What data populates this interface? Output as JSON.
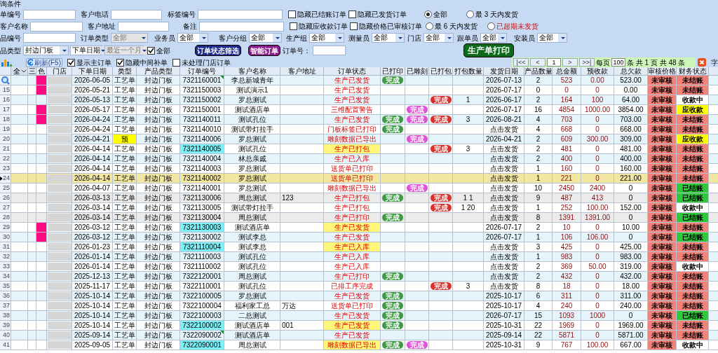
{
  "panel": {
    "title": "询条件"
  },
  "filter_lines": [
    [
      {
        "kind": "text",
        "label": "单编号"
      },
      {
        "kind": "text",
        "label": "客户电话"
      },
      {
        "kind": "text",
        "label": "标签编号"
      },
      {
        "kind": "check",
        "label": "隐藏已结账订单",
        "checked": false
      },
      {
        "kind": "check",
        "label": "隐藏已发货订单",
        "checked": false
      },
      {
        "kind": "radio",
        "label": "全部",
        "selected": true
      },
      {
        "kind": "radio",
        "label": "最 3 天内发货",
        "selected": false
      }
    ],
    [
      {
        "kind": "text",
        "label": "客户名称"
      },
      {
        "kind": "text",
        "label": "客户地址"
      },
      {
        "kind": "text",
        "label": "备注"
      },
      {
        "kind": "check",
        "label": "隐藏应收款订单",
        "checked": false
      },
      {
        "kind": "check",
        "label": "隐藏价格已审核订单",
        "checked": false
      },
      {
        "kind": "radio",
        "label": "最 6 天内发货",
        "selected": false
      },
      {
        "kind": "radio",
        "label": "已超期未发货",
        "selected": false,
        "warning": true
      }
    ],
    [
      {
        "kind": "text",
        "label": "品编号"
      },
      {
        "kind": "select",
        "label": "订单类型",
        "value": "全部",
        "disabled": true
      },
      {
        "kind": "select",
        "label": "业务员",
        "value": "全部",
        "disabled": false
      },
      {
        "kind": "select",
        "label": "客户分组",
        "value": "全部",
        "disabled": false
      },
      {
        "kind": "select",
        "label": "生产组",
        "value": "全部",
        "disabled": false
      },
      {
        "kind": "select",
        "label": "测量员",
        "value": "全部",
        "disabled": false
      },
      {
        "kind": "select",
        "label": "门店",
        "value": "全部",
        "disabled": false
      },
      {
        "kind": "select",
        "label": "跟单员",
        "value": "全部",
        "disabled": false
      },
      {
        "kind": "select",
        "label": "安装员",
        "value": "全部",
        "disabled": false
      }
    ],
    [
      {
        "kind": "select",
        "label": "品类型",
        "value": "封边门板",
        "disabled": false
      },
      {
        "kind": "select",
        "value": "下单日期",
        "disabled": false
      },
      {
        "kind": "select",
        "value": "最近一个月",
        "disabled": true
      },
      {
        "kind": "check",
        "label": "全部",
        "checked": true
      },
      {
        "kind": "button",
        "label": "订单状态筛选",
        "color": "#1c2a8a"
      },
      {
        "kind": "button",
        "label": "智能订单",
        "color": "#8a1a8a"
      },
      {
        "kind": "text",
        "label": "订单号："
      },
      {
        "kind": "button",
        "label": "生产单打印",
        "color": "#0b6b1a"
      }
    ]
  ],
  "toolbar": {
    "refresh": "刷新(F5)",
    "checks": [
      {
        "label": "显示主订单",
        "checked": true
      },
      {
        "label": "隐藏中间补单",
        "checked": true
      },
      {
        "label": "未处理门店订单",
        "checked": false
      }
    ]
  },
  "pagination": {
    "first": "|<<",
    "prev": "<",
    "page": "1",
    "next": ">",
    "last": ">>|",
    "per_page_label": "每页",
    "per_page": "100",
    "summary": "条 共 1 页 共 48 条",
    "cut_label": "字"
  },
  "columns": [
    "全",
    "三",
    "色",
    "门店",
    "下单日期",
    "类型",
    "产品类型",
    "订单编号",
    "客户名称",
    "客户地址",
    "订单状态",
    "已打印",
    "已雕刻",
    "已打包",
    "打包数量",
    "发货日期",
    "产品数量",
    "总金额",
    "预收款",
    "总欠款",
    "审核价格",
    "财务状态"
  ],
  "rows": [
    {
      "selected": false,
      "grayed": false,
      "color": "#ff0a80",
      "date": "2026-06-05",
      "type": "工艺单",
      "product": "封边门板",
      "order": "7321160001",
      "note": true,
      "customer": "李总新城青年",
      "status": "生产已发货",
      "printed": "完成",
      "ship": "2026-07-13",
      "qty": "2",
      "total": "523",
      "prepaid": "0.00",
      "owing": "523.00",
      "audit": "未审核",
      "finance": {
        "label": "未结账",
        "color": "#f2827a"
      }
    },
    {
      "no": "15",
      "selected": false,
      "grayed": false,
      "color": "#ff0a80",
      "date": "2026-05-21",
      "type": "工艺单",
      "product": "封边门板",
      "order": "7321150003",
      "customer": "测试演示1",
      "status": "生产已发货",
      "ship": "2026-07-17",
      "qty": "0",
      "total": "0",
      "prepaid": "0",
      "owing": "0.00",
      "audit": "未审核",
      "finance": {
        "label": "未结账",
        "color": "#f2827a"
      }
    },
    {
      "no": "16",
      "selected": false,
      "grayed": false,
      "date": "2026-05-13",
      "type": "工艺单",
      "product": "封边门板",
      "order": "7321150002",
      "customer": "罗总测试",
      "status": "生产已发货",
      "packed": "完成",
      "pack_qty": "1",
      "ship": "2026-06-17",
      "qty": "2",
      "total": "164",
      "prepaid": "100",
      "owing": "64.00",
      "audit": "未审核",
      "finance": {
        "label": "收款中",
        "color": "#ffffff"
      }
    },
    {
      "no": "17",
      "selected": false,
      "grayed": false,
      "color": "#ff0a80",
      "date": "2026-05-17",
      "type": "工艺单",
      "product": "封边门板",
      "order": "7321150001",
      "customer": "测试酒店单",
      "status": "三维配置警告",
      "engraved": "完成",
      "ship": "2026-07-17",
      "qty": "16",
      "total": "4854",
      "prepaid": "1000.00",
      "owing": "3854.00",
      "audit": "未审核",
      "finance": {
        "label": "应收款",
        "color": "#ffff00"
      }
    },
    {
      "no": "18",
      "selected": false,
      "grayed": false,
      "color": "#ff0a80",
      "date": "2026-04-24",
      "type": "工艺单",
      "product": "封边门板",
      "order": "7321140011",
      "customer": "测试孔位",
      "status": "生产已发货",
      "printed": "完成",
      "engraved": "完成",
      "packed": "完成",
      "pack_qty": "3",
      "ship": "2026-08-21",
      "qty": "4",
      "total": "703",
      "prepaid": "0",
      "owing": "703.00",
      "audit": "未审核",
      "finance": {
        "label": "未结账",
        "color": "#f2827a"
      }
    },
    {
      "no": "19",
      "selected": false,
      "grayed": false,
      "date": "2026-04-24",
      "type": "工艺单",
      "product": "封边门板",
      "order": "7321140010",
      "customer": "测试带灯拉手",
      "status": "门板标签已打印",
      "printed": "完成",
      "ship": "点击发货",
      "qty": "4",
      "total": "668",
      "prepaid": "0",
      "owing": "668.00",
      "audit": "未审核",
      "finance": {
        "label": "未结账",
        "color": "#f2827a"
      }
    },
    {
      "no": "20",
      "selected": false,
      "grayed": false,
      "date": "2026-04-21",
      "type": "预",
      "type_hl": true,
      "product": "封边门板",
      "order": "7321140006",
      "customer": "罗总测试",
      "status": "雕刻数据已导出",
      "engraved": "完成",
      "ship": "2026-04-21",
      "qty": "2",
      "total": "609",
      "prepaid": "300.00",
      "owing": "309.00",
      "audit": "未审核",
      "finance": {
        "label": "应收款",
        "color": "#ffff00"
      }
    },
    {
      "no": "21",
      "selected": false,
      "grayed": false,
      "date": "2026-04-14",
      "type": "工艺单",
      "product": "封边门板",
      "order": "7321140005",
      "order_hl": true,
      "customer": "测试孔位",
      "status": "生产已打包",
      "status_hl": true,
      "packed": "完成",
      "pack_qty": "3",
      "ship": "点击发货",
      "qty": "2",
      "total": "481",
      "prepaid": "0",
      "owing": "481.00",
      "audit": "未审核",
      "finance": {
        "label": "未结账",
        "color": "#f2827a"
      }
    },
    {
      "no": "22",
      "selected": false,
      "grayed": false,
      "date": "2026-04-14",
      "type": "工艺单",
      "product": "封边门板",
      "order": "7321140004",
      "customer": "林总亲戚",
      "status": "生产已入库",
      "ship": "点击发货",
      "qty": "2",
      "total": "400",
      "prepaid": "0",
      "owing": "400.00",
      "audit": "未审核",
      "finance": {
        "label": "未结账",
        "color": "#f2827a"
      }
    },
    {
      "no": "23",
      "selected": false,
      "grayed": false,
      "date": "2026-04-14",
      "type": "工艺单",
      "product": "封边门板",
      "order": "7321140003",
      "customer": "罗总测试",
      "status": "送货单已打印",
      "ship": "点击发货",
      "qty": "1",
      "total": "160",
      "prepaid": "0",
      "owing": "160.00",
      "audit": "未审核",
      "finance": {
        "label": "未结账",
        "color": "#f2827a"
      }
    },
    {
      "no": "24",
      "selected": true,
      "grayed": false,
      "date": "2026-04-14",
      "type": "工艺单",
      "product": "封边门板",
      "order": "7321140002",
      "customer": "罗总测试",
      "status": "送货单已打印",
      "ship": "点击发货",
      "qty": "1",
      "total": "221",
      "prepaid": "0",
      "owing": "221.00",
      "audit": "未审核",
      "finance": {
        "label": "未结账",
        "color": "#f2827a"
      }
    },
    {
      "no": "25",
      "selected": false,
      "grayed": false,
      "date": "2026-04-07",
      "type": "工艺单",
      "product": "封边门板",
      "order": "7321140001",
      "customer": "罗总测试",
      "status": "雕刻数据已导出",
      "engraved": "完成",
      "ship": "点击发货",
      "qty": "10",
      "total": "2450",
      "prepaid": "2400",
      "owing": "0",
      "audit": "未审核",
      "finance": {
        "label": "已结账",
        "color": "#2fca3a"
      }
    },
    {
      "no": "26",
      "selected": false,
      "grayed": true,
      "date": "2026-03-13",
      "type": "工艺单",
      "product": "封边门板",
      "order": "7321130006",
      "customer": "周总测试",
      "address": "123",
      "status": "生产已打包",
      "printed": "完成",
      "packed": "完成",
      "pack_qty": "1 1",
      "ship": "点击发货",
      "qty": "9",
      "total": "487",
      "prepaid": "413",
      "owing": "0",
      "audit": "未审核",
      "finance": {
        "label": "已结账",
        "color": "#2fca3a"
      }
    },
    {
      "no": "27",
      "selected": false,
      "grayed": false,
      "date": "2026-03-14",
      "type": "工艺单",
      "product": "封边门板",
      "order": "7321130005",
      "customer": "测试带灯拉手",
      "status": "生产已打包",
      "packed": "完成",
      "pack_qty": "1 20",
      "ship": "点击发货",
      "qty": "1",
      "total": "252",
      "prepaid": "100.00",
      "owing": "152.00",
      "audit": "未审核",
      "finance": {
        "label": "收款中",
        "color": "#ffffff"
      }
    },
    {
      "no": "28",
      "selected": false,
      "grayed": true,
      "date": "2026-03-14",
      "type": "工艺单",
      "product": "封边门板",
      "order": "7321130004",
      "customer": "周总测试",
      "status": "生产已打印",
      "printed": "完成",
      "ship": "点击发货",
      "qty": "8",
      "total": "1391",
      "prepaid": "1391.00",
      "owing": "0",
      "audit": "未审核",
      "finance": {
        "label": "已结账",
        "color": "#2fca3a"
      }
    },
    {
      "no": "29",
      "selected": false,
      "grayed": false,
      "color": "#ff0a80",
      "date": "2026-03-12",
      "type": "工艺单",
      "product": "封边门板",
      "order": "7321130003",
      "order_hl": true,
      "customer": "测试酒店单",
      "status": "生产已发货",
      "status_hl": true,
      "ship": "2026-07-17",
      "qty": "2",
      "total": "10",
      "prepaid": "0",
      "owing": "10.00",
      "audit": "未审核",
      "finance": {
        "label": "未结账",
        "color": "#f2827a"
      }
    },
    {
      "no": "30",
      "selected": false,
      "grayed": false,
      "color": "#ff0a80",
      "date": "2026-03-12",
      "type": "工艺单",
      "product": "封边门板",
      "order": "7321130002",
      "customer": "测试李总",
      "status": "生产已发货",
      "ship": "2026-07-17",
      "qty": "1",
      "total": "106",
      "prepaid": "106.00",
      "owing": "0",
      "audit": "未审核",
      "finance": {
        "label": "已结账",
        "color": "#2fca3a"
      }
    },
    {
      "no": "31",
      "selected": false,
      "grayed": false,
      "date": "2026-01-23",
      "type": "工艺单",
      "product": "封边门板",
      "order": "7321110004",
      "order_hl": true,
      "customer": "测试李总",
      "status": "生产已入库",
      "status_hl": true,
      "ship": "点击发货",
      "qty": "3",
      "total": "425",
      "prepaid": "0",
      "owing": "425.00",
      "audit": "未审核",
      "finance": {
        "label": "未结账",
        "color": "#f2827a"
      }
    },
    {
      "no": "32",
      "selected": false,
      "grayed": false,
      "date": "2026-01-14",
      "type": "工艺单",
      "product": "封边门板",
      "order": "7321110003",
      "customer": "测试孔位",
      "status": "生产已入库",
      "ship": "点击发货",
      "qty": "1",
      "total": "983",
      "prepaid": "0",
      "owing": "983.00",
      "audit": "未审核",
      "finance": {
        "label": "未结账",
        "color": "#f2827a"
      }
    },
    {
      "no": "33",
      "selected": false,
      "grayed": false,
      "date": "2026-01-14",
      "type": "工艺单",
      "product": "封边门板",
      "order": "7321110002",
      "customer": "测试孔位",
      "status": "生产已入库",
      "ship": "点击发货",
      "qty": "2",
      "total": "369",
      "prepaid": "50.00",
      "owing": "319.00",
      "audit": "未审核",
      "finance": {
        "label": "收款中",
        "color": "#ffffff"
      }
    },
    {
      "no": "34",
      "selected": false,
      "grayed": false,
      "date": "2025-12-13",
      "type": "工艺单",
      "product": "封边门板",
      "order": "7322120001",
      "customer": "周总测试",
      "status": "生产已打印",
      "printed": "完成",
      "ship": "点击发货",
      "qty": "2",
      "total": "432",
      "prepaid": "0",
      "owing": "432.00",
      "audit": "未审核",
      "finance": {
        "label": "未结账",
        "color": "#f2827a"
      }
    },
    {
      "no": "35",
      "selected": false,
      "grayed": false,
      "date": "2025-11-17",
      "type": "工艺单",
      "product": "封边门板",
      "order": "7322110001",
      "customer": "测试孔位",
      "status": "已排工序完成",
      "packed": "完成",
      "pack_qty": "3",
      "ship": "点击发货",
      "qty": "8",
      "total": "18",
      "prepaid": "0",
      "owing": "18.00",
      "audit": "未审核",
      "finance": {
        "label": "未结账",
        "color": "#f2827a"
      }
    },
    {
      "no": "36",
      "selected": false,
      "grayed": false,
      "date": "2025-10-14",
      "type": "工艺单",
      "product": "封边门板",
      "order": "7322100005",
      "customer": "罗总测试",
      "status": "生产已发货",
      "printed": "完成",
      "ship": "2025-10-17",
      "qty": "6",
      "total": "311",
      "prepaid": "0",
      "owing": "311.00",
      "audit": "未审核",
      "finance": {
        "label": "未结账",
        "color": "#f2827a"
      }
    },
    {
      "no": "37",
      "selected": false,
      "grayed": false,
      "date": "2025-10-14",
      "type": "工艺单",
      "product": "封边门板",
      "order": "7322100004",
      "customer": "福利家工总",
      "address": "万达",
      "status": "送货单已打印",
      "printed": "完成",
      "ship": "2025-10-17",
      "qty": "4",
      "total": "240",
      "prepaid": "0",
      "owing": "240.00",
      "audit": "未审核",
      "finance": {
        "label": "未结账",
        "color": "#f2827a"
      }
    },
    {
      "no": "38",
      "selected": false,
      "grayed": false,
      "date": "2025-10-14",
      "type": "工艺单",
      "product": "封边门板",
      "order": "7322100003",
      "customer": "二总测试",
      "status": "生产已发货",
      "printed": "完成",
      "ship": "2026-07-17",
      "qty": "15",
      "total": "1093",
      "prepaid": "1000",
      "owing": "0",
      "audit": "未审核",
      "finance": {
        "label": "已结账",
        "color": "#2fca3a"
      }
    },
    {
      "no": "39",
      "selected": false,
      "grayed": false,
      "date": "2025-10-14",
      "type": "工艺单",
      "product": "封边门板",
      "order": "7322100002",
      "order_hl": true,
      "customer": "测试酒店单",
      "address": "001",
      "status": "生产已发货",
      "status_hl": true,
      "printed": "完成",
      "ship": "2025-10-31",
      "qty": "22",
      "total": "1969",
      "prepaid": "0",
      "owing": "1969.00",
      "audit": "未审核",
      "finance": {
        "label": "未结账",
        "color": "#f2827a"
      }
    },
    {
      "no": "40",
      "selected": false,
      "grayed": false,
      "date": "2025-09-14",
      "type": "工艺单",
      "product": "封边门板",
      "order": "7322090002",
      "note": true,
      "customer": "测试酒店单",
      "status": "生产已发货",
      "ship": "2025-09-14",
      "qty": "22",
      "total": "5871",
      "prepaid": "0",
      "owing": "5871.00",
      "audit": "未审核",
      "finance": {
        "label": "未结账",
        "color": "#f2827a"
      }
    },
    {
      "no": "41",
      "selected": false,
      "grayed": false,
      "date": "2025-09-05",
      "type": "工艺单",
      "product": "封边门板",
      "order": "7322090001",
      "order_hl": true,
      "customer": "周总测试",
      "status": "雕刻数据已导出",
      "status_hl": true,
      "printed": "完成",
      "engraved": "完成",
      "ship": "2025-10-31",
      "qty": "9",
      "total": "767",
      "prepaid": "100.00",
      "owing": "667.00",
      "audit": "未审核",
      "finance": {
        "label": "收款中",
        "color": "#ffffff"
      }
    }
  ]
}
